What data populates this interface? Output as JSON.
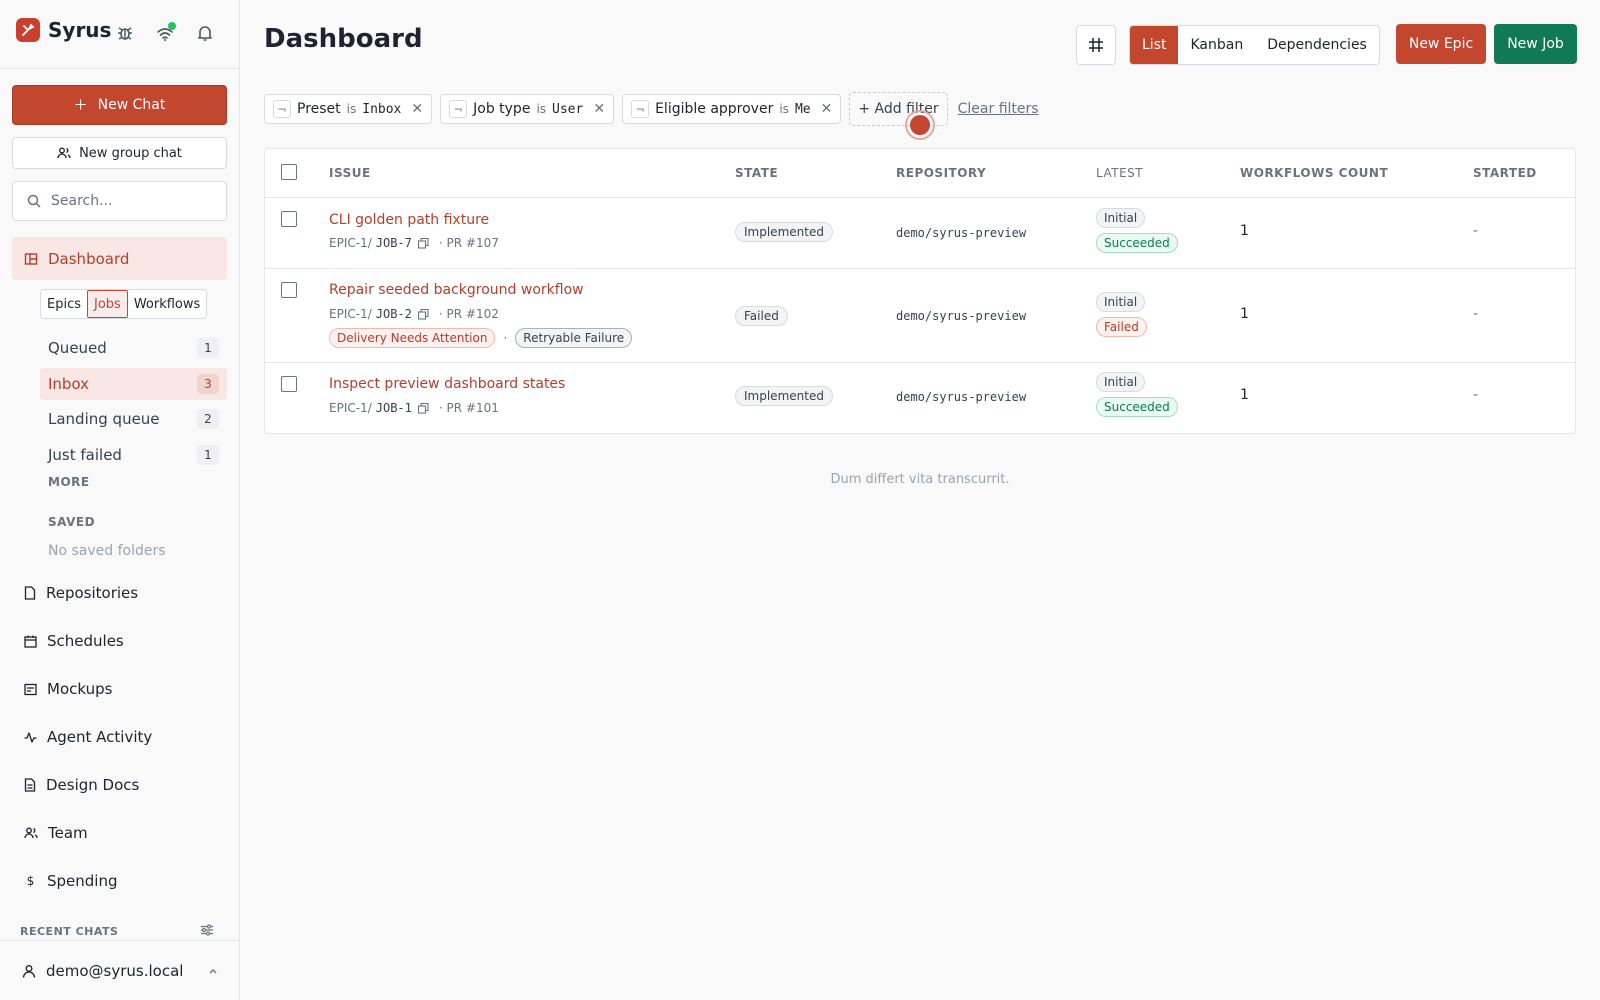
{
  "app": {
    "name": "Syrus"
  },
  "sidebar": {
    "new_chat": "New Chat",
    "new_group_chat": "New group chat",
    "search_placeholder": "Search...",
    "active_nav": "Dashboard",
    "segments": [
      "Epics",
      "Jobs",
      "Workflows"
    ],
    "active_segment": "Jobs",
    "queues": [
      {
        "label": "Queued",
        "count": "1"
      },
      {
        "label": "Inbox",
        "count": "3"
      },
      {
        "label": "Landing queue",
        "count": "2"
      },
      {
        "label": "Just failed",
        "count": "1"
      }
    ],
    "more_label": "MORE",
    "saved_label": "SAVED",
    "no_saved": "No saved folders",
    "nav": [
      "Repositories",
      "Schedules",
      "Mockups",
      "Agent Activity",
      "Design Docs",
      "Team",
      "Spending"
    ],
    "recent_chats": "RECENT CHATS",
    "user": "demo@syrus.local"
  },
  "header": {
    "title": "Dashboard",
    "views": [
      "List",
      "Kanban",
      "Dependencies"
    ],
    "active_view": "List",
    "new_epic": "New Epic",
    "new_job": "New Job"
  },
  "filters": [
    {
      "field": "Preset",
      "op": "is",
      "value": "Inbox"
    },
    {
      "field": "Job type",
      "op": "is",
      "value": "User"
    },
    {
      "field": "Eligible approver",
      "op": "is",
      "value": "Me"
    }
  ],
  "filter_actions": {
    "add": "+ Add filter",
    "clear": "Clear filters"
  },
  "table": {
    "columns": [
      "ISSUE",
      "STATE",
      "REPOSITORY",
      "LATEST",
      "WORKFLOWS COUNT",
      "STARTED"
    ],
    "rows": [
      {
        "title": "CLI golden path fixture",
        "epic": "EPIC-1/",
        "job": "JOB-7",
        "pr": "· PR #107",
        "tags": [],
        "state": "Implemented",
        "repo": "demo/syrus-preview",
        "phase": "Initial",
        "status": "Succeeded",
        "workflows": "1",
        "started": "-"
      },
      {
        "title": "Repair seeded background workflow",
        "epic": "EPIC-1/",
        "job": "JOB-2",
        "pr": "· PR #102",
        "tags": [
          "Delivery Needs Attention",
          "Retryable Failure"
        ],
        "tag_separator": "·",
        "state": "Failed",
        "repo": "demo/syrus-preview",
        "phase": "Initial",
        "status": "Failed",
        "workflows": "1",
        "started": "-"
      },
      {
        "title": "Inspect preview dashboard states",
        "epic": "EPIC-1/",
        "job": "JOB-1",
        "pr": "· PR #101",
        "tags": [],
        "state": "Implemented",
        "repo": "demo/syrus-preview",
        "phase": "Initial",
        "status": "Succeeded",
        "workflows": "1",
        "started": "-"
      }
    ]
  },
  "footer_note": "Dum differt vita transcurrit.",
  "colors": {
    "accent": "#c3462f",
    "success": "#0f7a55"
  }
}
